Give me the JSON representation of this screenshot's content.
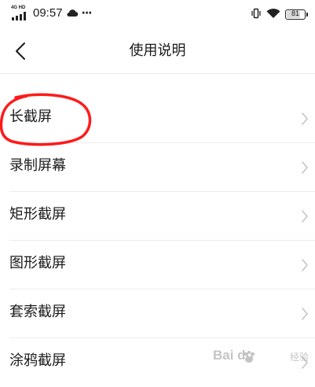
{
  "status_bar": {
    "network": "4G HD",
    "time": "09:57",
    "more": "···",
    "battery_level": "81",
    "battery_fraction": 0.81
  },
  "header": {
    "title": "使用说明"
  },
  "list": {
    "items": [
      {
        "label": "长截屏"
      },
      {
        "label": "录制屏幕"
      },
      {
        "label": "矩形截屏"
      },
      {
        "label": "图形截屏"
      },
      {
        "label": "套索截屏"
      },
      {
        "label": "涂鸦截屏"
      }
    ]
  },
  "annotation": {
    "color": "#ff1a1a"
  },
  "watermark": {
    "brand": "Bai du",
    "sub": "经验"
  },
  "colors": {
    "text": "#1a1a1a",
    "divider": "#ececec",
    "chevron": "#c2c2c2",
    "annotation": "#ff1a1a"
  }
}
